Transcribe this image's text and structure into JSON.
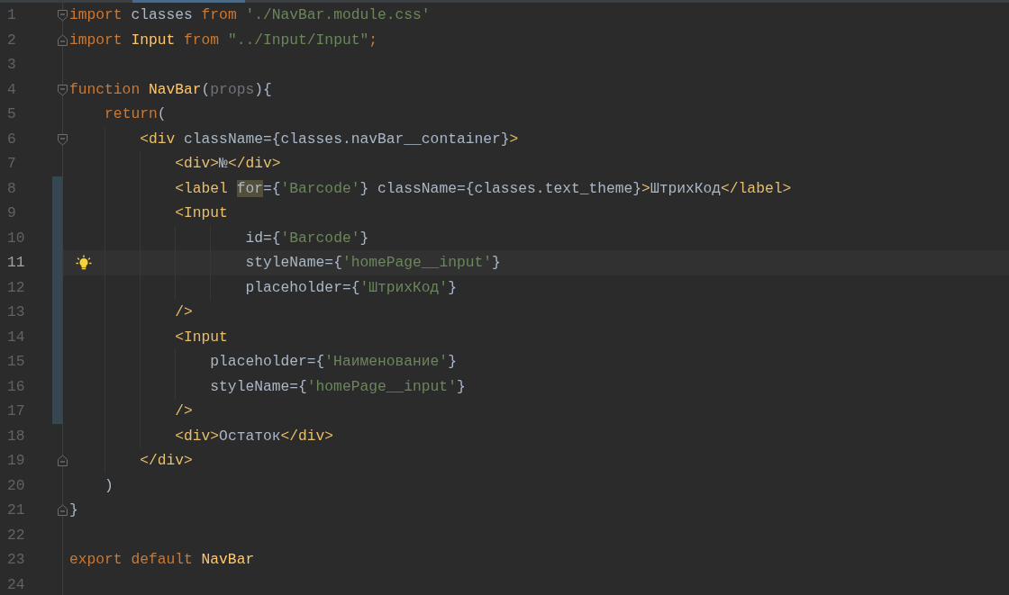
{
  "lines": [
    {
      "number": "1",
      "fold_start": true,
      "fold_end": false,
      "changed": false,
      "current": false,
      "bulb": false,
      "tokens": [
        {
          "kind": "kw",
          "text": "import "
        },
        {
          "kind": "plain",
          "text": "classes "
        },
        {
          "kind": "kw",
          "text": "from "
        },
        {
          "kind": "str",
          "text": "'./NavBar.module.css'"
        }
      ]
    },
    {
      "number": "2",
      "fold_start": false,
      "fold_end": true,
      "changed": false,
      "current": false,
      "bulb": false,
      "tokens": [
        {
          "kind": "kw",
          "text": "import "
        },
        {
          "kind": "fn",
          "text": "Input "
        },
        {
          "kind": "kw",
          "text": "from "
        },
        {
          "kind": "str",
          "text": "\"../Input/Input\""
        },
        {
          "kind": "kw",
          "text": ";"
        }
      ]
    },
    {
      "number": "3",
      "fold_start": false,
      "fold_end": false,
      "changed": false,
      "current": false,
      "bulb": false
    },
    {
      "number": "4",
      "fold_start": true,
      "fold_end": false,
      "changed": false,
      "current": false,
      "bulb": false,
      "tokens": [
        {
          "kind": "kw",
          "text": "function "
        },
        {
          "kind": "fn",
          "text": "NavBar"
        },
        {
          "kind": "plain",
          "text": "("
        },
        {
          "kind": "param",
          "text": "props"
        },
        {
          "kind": "plain",
          "text": "){"
        }
      ]
    },
    {
      "number": "5",
      "fold_start": false,
      "fold_end": false,
      "changed": false,
      "current": false,
      "bulb": false,
      "tokens": [
        {
          "kind": "kw",
          "text": "    return"
        },
        {
          "kind": "plain",
          "text": "("
        }
      ]
    },
    {
      "number": "6",
      "fold_start": true,
      "fold_end": false,
      "changed": false,
      "current": false,
      "bulb": false,
      "tokens": [
        {
          "kind": "tag",
          "text": "        <div"
        },
        {
          "kind": "plain",
          "text": " className={classes.navBar__container}"
        },
        {
          "kind": "tag",
          "text": ">"
        }
      ]
    },
    {
      "number": "7",
      "fold_start": false,
      "fold_end": false,
      "changed": false,
      "current": false,
      "bulb": false,
      "tokens": [
        {
          "kind": "tag",
          "text": "            <div>"
        },
        {
          "kind": "plain",
          "text": "№"
        },
        {
          "kind": "tag",
          "text": "</div>"
        }
      ]
    },
    {
      "number": "8",
      "fold_start": false,
      "fold_end": false,
      "changed": true,
      "current": false,
      "bulb": false,
      "tokens": [
        {
          "kind": "tag",
          "text": "            <label "
        },
        {
          "kind": "plain",
          "text": "for",
          "highlighted": true
        },
        {
          "kind": "plain",
          "text": "={"
        },
        {
          "kind": "str",
          "text": "'Barcode'"
        },
        {
          "kind": "plain",
          "text": "} className={classes.text_theme}"
        },
        {
          "kind": "tag",
          "text": ">"
        },
        {
          "kind": "plain",
          "text": "ШтрихКод"
        },
        {
          "kind": "tag",
          "text": "</label>"
        }
      ]
    },
    {
      "number": "9",
      "fold_start": false,
      "fold_end": false,
      "changed": true,
      "current": false,
      "bulb": false,
      "tokens": [
        {
          "kind": "tag",
          "text": "            <Input"
        }
      ]
    },
    {
      "number": "10",
      "fold_start": false,
      "fold_end": false,
      "changed": true,
      "current": false,
      "bulb": false,
      "tokens": [
        {
          "kind": "plain",
          "text": "                    id={"
        },
        {
          "kind": "str",
          "text": "'Barcode'"
        },
        {
          "kind": "plain",
          "text": "}"
        }
      ]
    },
    {
      "number": "11",
      "fold_start": false,
      "fold_end": false,
      "changed": true,
      "current": true,
      "bulb": true,
      "tokens": [
        {
          "kind": "plain",
          "text": "                    styleName={"
        },
        {
          "kind": "str",
          "text": "'homePage__input'"
        },
        {
          "kind": "plain",
          "text": "}"
        }
      ]
    },
    {
      "number": "12",
      "fold_start": false,
      "fold_end": false,
      "changed": true,
      "current": false,
      "bulb": false,
      "tokens": [
        {
          "kind": "plain",
          "text": "                    placeholder={"
        },
        {
          "kind": "str",
          "text": "'ШтрихКод'"
        },
        {
          "kind": "plain",
          "text": "}"
        }
      ]
    },
    {
      "number": "13",
      "fold_start": false,
      "fold_end": false,
      "changed": true,
      "current": false,
      "bulb": false,
      "tokens": [
        {
          "kind": "tag",
          "text": "            />"
        }
      ]
    },
    {
      "number": "14",
      "fold_start": false,
      "fold_end": false,
      "changed": true,
      "current": false,
      "bulb": false,
      "tokens": [
        {
          "kind": "tag",
          "text": "            <Input"
        }
      ]
    },
    {
      "number": "15",
      "fold_start": false,
      "fold_end": false,
      "changed": true,
      "current": false,
      "bulb": false,
      "tokens": [
        {
          "kind": "plain",
          "text": "                placeholder={"
        },
        {
          "kind": "str",
          "text": "'Наименование'"
        },
        {
          "kind": "plain",
          "text": "}"
        }
      ]
    },
    {
      "number": "16",
      "fold_start": false,
      "fold_end": false,
      "changed": true,
      "current": false,
      "bulb": false,
      "tokens": [
        {
          "kind": "plain",
          "text": "                styleName={"
        },
        {
          "kind": "str",
          "text": "'homePage__input'"
        },
        {
          "kind": "plain",
          "text": "}"
        }
      ]
    },
    {
      "number": "17",
      "fold_start": false,
      "fold_end": false,
      "changed": true,
      "current": false,
      "bulb": false,
      "tokens": [
        {
          "kind": "tag",
          "text": "            />"
        }
      ]
    },
    {
      "number": "18",
      "fold_start": false,
      "fold_end": false,
      "changed": false,
      "current": false,
      "bulb": false,
      "tokens": [
        {
          "kind": "tag",
          "text": "            <div>"
        },
        {
          "kind": "plain",
          "text": "Остаток"
        },
        {
          "kind": "tag",
          "text": "</div>"
        }
      ]
    },
    {
      "number": "19",
      "fold_start": false,
      "fold_end": true,
      "changed": false,
      "current": false,
      "bulb": false,
      "tokens": [
        {
          "kind": "tag",
          "text": "        </div>"
        }
      ]
    },
    {
      "number": "20",
      "fold_start": false,
      "fold_end": false,
      "changed": false,
      "current": false,
      "bulb": false,
      "tokens": [
        {
          "kind": "plain",
          "text": "    )"
        }
      ]
    },
    {
      "number": "21",
      "fold_start": false,
      "fold_end": true,
      "changed": false,
      "current": false,
      "bulb": false,
      "tokens": [
        {
          "kind": "plain",
          "text": "}"
        }
      ]
    },
    {
      "number": "22",
      "fold_start": false,
      "fold_end": false,
      "changed": false,
      "current": false,
      "bulb": false
    },
    {
      "number": "23",
      "fold_start": false,
      "fold_end": false,
      "changed": false,
      "current": false,
      "bulb": false,
      "tokens": [
        {
          "kind": "kw",
          "text": "export default "
        },
        {
          "kind": "fn",
          "text": "NavBar"
        }
      ]
    },
    {
      "number": "24",
      "fold_start": false,
      "fold_end": false,
      "changed": false,
      "current": false,
      "bulb": false
    }
  ]
}
